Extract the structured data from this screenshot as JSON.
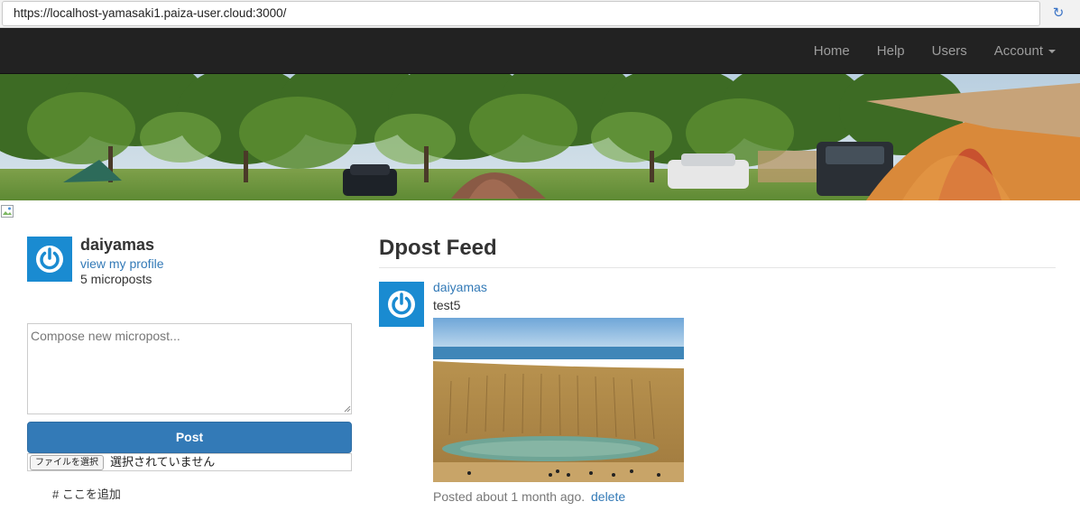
{
  "browser": {
    "url": "https://localhost-yamasaki1.paiza-user.cloud:3000/",
    "reload_icon": "reload-icon"
  },
  "navbar": {
    "items": [
      {
        "label": "Home"
      },
      {
        "label": "Help"
      },
      {
        "label": "Users"
      },
      {
        "label": "Account",
        "has_caret": true
      }
    ]
  },
  "user_info": {
    "name": "daiyamas",
    "profile_link": "view my profile",
    "micropost_count": "5 microposts"
  },
  "compose": {
    "placeholder": "Compose new micropost...",
    "post_label": "Post",
    "file_button_label": "ファイルを選択",
    "file_status": "選択されていません",
    "add_tag_text": "# ここを追加"
  },
  "feed": {
    "title": "Dpost Feed",
    "items": [
      {
        "user": "daiyamas",
        "content": "test5",
        "timestamp": "Posted about 1 month ago.",
        "delete_label": "delete"
      }
    ]
  },
  "colors": {
    "navbar_bg": "#222222",
    "link": "#337ab7",
    "primary_button": "#337ab7",
    "avatar": "#1a8bd1"
  }
}
